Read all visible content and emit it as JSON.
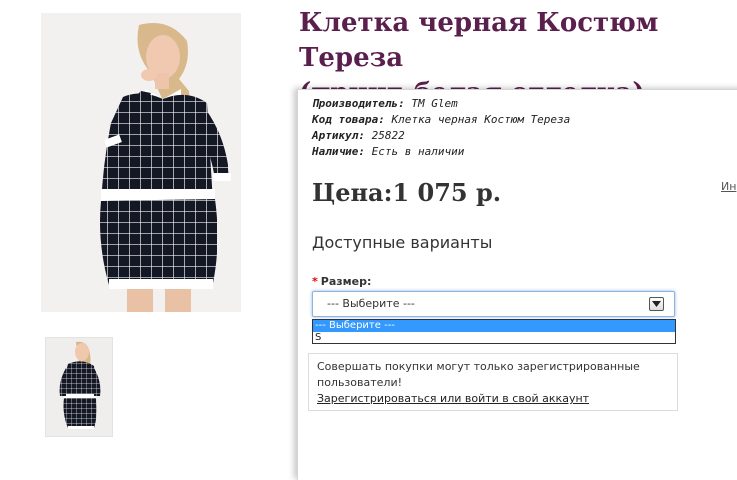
{
  "product": {
    "title": "Клетка черная Костюм Тереза\n(принт-белая отделка)",
    "meta": [
      {
        "label": "Производитель:",
        "value": "TM Glem"
      },
      {
        "label": "Код товара:",
        "value": "Клетка черная Костюм Тереза"
      },
      {
        "label": "Артикул:",
        "value": "25822"
      },
      {
        "label": "Наличие:",
        "value": "Есть в наличии"
      }
    ],
    "price": "Цена:1 075 р.",
    "side_link": "Ин"
  },
  "variants": {
    "heading": "Доступные варианты",
    "size_label": "Размер:",
    "required_mark": "*",
    "selected": "--- Выберите ---",
    "options": [
      "--- Выберите ---",
      "S"
    ]
  },
  "notice": {
    "text": "Совершать покупки могут только зарегистрированные пользователи!",
    "link": "Зарегистрироваться или войти в свой аккаунт"
  },
  "colors": {
    "title": "#5a1f4c",
    "option_highlight": "#3399ff",
    "required": "#ee0000"
  }
}
